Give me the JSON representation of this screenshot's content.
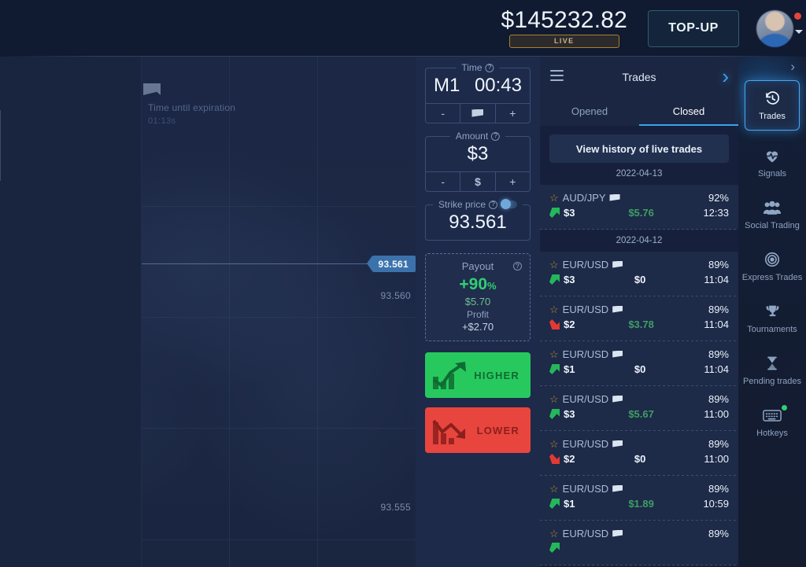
{
  "topbar": {
    "balance": "$145232.82",
    "account_badge": "LIVE",
    "topup_label": "TOP-UP",
    "avatar_name": "avatar",
    "expander_glyph": "›"
  },
  "chart": {
    "expiration_title": "Time until expiration",
    "expiration_value": "01:13s",
    "current_price": "93.561",
    "axis_labels": [
      "93.560",
      "93.555"
    ]
  },
  "trade_panel": {
    "time": {
      "legend": "Time",
      "mode": "M1",
      "countdown": "00:43",
      "minus": "-",
      "plus": "+",
      "flag_icon": "flag-icon"
    },
    "amount": {
      "legend": "Amount",
      "value": "$3",
      "minus": "-",
      "currency": "$",
      "plus": "+"
    },
    "strike": {
      "legend": "Strike price",
      "value": "93.561",
      "toggle_on": true
    },
    "payout": {
      "title": "Payout",
      "percent": "+90",
      "percent_unit": "%",
      "amount": "$5.70",
      "profit_label": "Profit",
      "profit_value": "+$2.70"
    },
    "higher_label": "HIGHER",
    "lower_label": "LOWER"
  },
  "trades_panel": {
    "title": "Trades",
    "tabs": [
      {
        "label": "Opened",
        "active": false
      },
      {
        "label": "Closed",
        "active": true
      }
    ],
    "history_button": "View history of live trades",
    "collapse_glyph": "›",
    "groups": [
      {
        "date": "2022-04-13",
        "rows": [
          {
            "pair": "AUD/JPY",
            "percent": "92%",
            "direction": "up",
            "amount": "$3",
            "profit": "$5.76",
            "profit_state": "pos",
            "time": "12:33"
          }
        ]
      },
      {
        "date": "2022-04-12",
        "rows": [
          {
            "pair": "EUR/USD",
            "percent": "89%",
            "direction": "up",
            "amount": "$3",
            "profit": "$0",
            "profit_state": "zero",
            "time": "11:04"
          },
          {
            "pair": "EUR/USD",
            "percent": "89%",
            "direction": "down",
            "amount": "$2",
            "profit": "$3.78",
            "profit_state": "pos",
            "time": "11:04"
          },
          {
            "pair": "EUR/USD",
            "percent": "89%",
            "direction": "up",
            "amount": "$1",
            "profit": "$0",
            "profit_state": "zero",
            "time": "11:04"
          },
          {
            "pair": "EUR/USD",
            "percent": "89%",
            "direction": "up",
            "amount": "$3",
            "profit": "$5.67",
            "profit_state": "pos",
            "time": "11:00"
          },
          {
            "pair": "EUR/USD",
            "percent": "89%",
            "direction": "down",
            "amount": "$2",
            "profit": "$0",
            "profit_state": "zero",
            "time": "11:00"
          },
          {
            "pair": "EUR/USD",
            "percent": "89%",
            "direction": "up",
            "amount": "$1",
            "profit": "$1.89",
            "profit_state": "pos",
            "time": "10:59"
          },
          {
            "pair": "EUR/USD",
            "percent": "89%",
            "direction": "up",
            "amount": "",
            "profit": "",
            "profit_state": "zero",
            "time": ""
          }
        ]
      }
    ]
  },
  "right_nav": {
    "items": [
      {
        "label": "Trades",
        "icon": "history-icon",
        "active": true
      },
      {
        "label": "Signals",
        "icon": "pulse-heart-icon",
        "active": false
      },
      {
        "label": "Social Trading",
        "icon": "people-icon",
        "active": false
      },
      {
        "label": "Express Trades",
        "icon": "target-icon",
        "active": false
      },
      {
        "label": "Tournaments",
        "icon": "trophy-icon",
        "active": false
      },
      {
        "label": "Pending trades",
        "icon": "hourglass-icon",
        "active": false
      },
      {
        "label": "Hotkeys",
        "icon": "keyboard-icon",
        "active": false
      }
    ]
  },
  "colors": {
    "accent_blue": "#3ba3ec",
    "green": "#27c95e",
    "red": "#e8453e",
    "panel_bg": "#1d2a4a",
    "gold": "#a8802f"
  }
}
